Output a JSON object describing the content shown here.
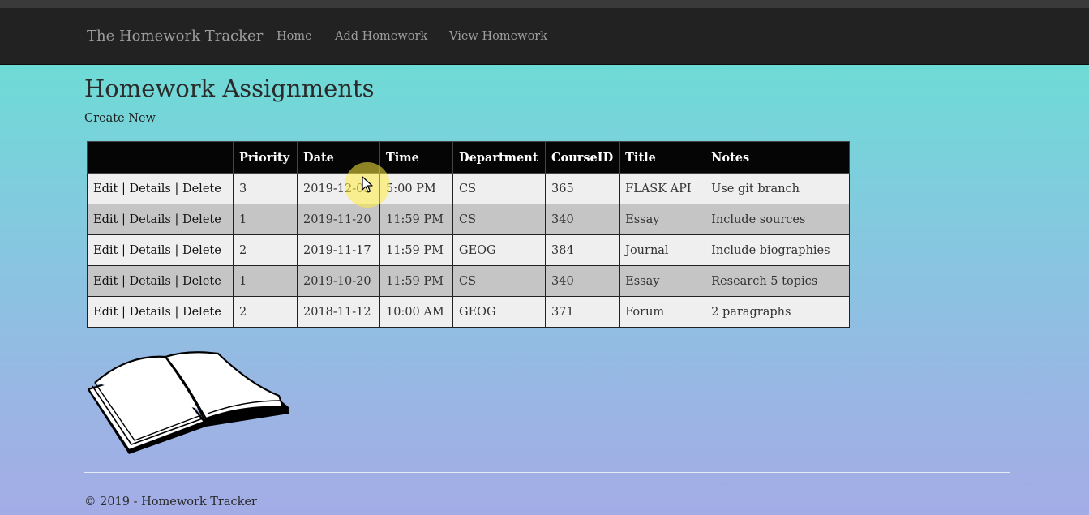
{
  "navbar": {
    "brand": "The Homework Tracker",
    "links": [
      "Home",
      "Add Homework",
      "View Homework"
    ]
  },
  "page": {
    "title": "Homework Assignments",
    "create_new": "Create New"
  },
  "table": {
    "headers": [
      "",
      "Priority",
      "Date",
      "Time",
      "Department",
      "CourseID",
      "Title",
      "Notes"
    ],
    "actions": {
      "edit": "Edit",
      "details": "Details",
      "delete": "Delete",
      "sep": "|"
    },
    "rows": [
      {
        "priority": "3",
        "date": "2019-12-05",
        "time": "5:00 PM",
        "department": "CS",
        "course_id": "365",
        "title": "FLASK API",
        "notes": "Use git branch"
      },
      {
        "priority": "1",
        "date": "2019-11-20",
        "time": "11:59 PM",
        "department": "CS",
        "course_id": "340",
        "title": "Essay",
        "notes": "Include sources"
      },
      {
        "priority": "2",
        "date": "2019-11-17",
        "time": "11:59 PM",
        "department": "GEOG",
        "course_id": "384",
        "title": "Journal",
        "notes": "Include biographies"
      },
      {
        "priority": "1",
        "date": "2019-10-20",
        "time": "11:59 PM",
        "department": "CS",
        "course_id": "340",
        "title": "Essay",
        "notes": "Research 5 topics"
      },
      {
        "priority": "2",
        "date": "2018-11-12",
        "time": "10:00 AM",
        "department": "GEOG",
        "course_id": "371",
        "title": "Forum",
        "notes": "2 paragraphs"
      }
    ]
  },
  "footer": {
    "text": "© 2019 - Homework Tracker"
  },
  "icons": {
    "book": "open-book-icon",
    "cursor": "mouse-pointer-icon"
  },
  "colors": {
    "navbar_bg": "#222222",
    "nav_text": "#9d9d9d",
    "table_header_bg": "#050505",
    "row_light": "#efefef",
    "row_dark": "#c5c5c5",
    "gradient_top": "#6edbd6",
    "gradient_bottom": "#a4ace6"
  }
}
